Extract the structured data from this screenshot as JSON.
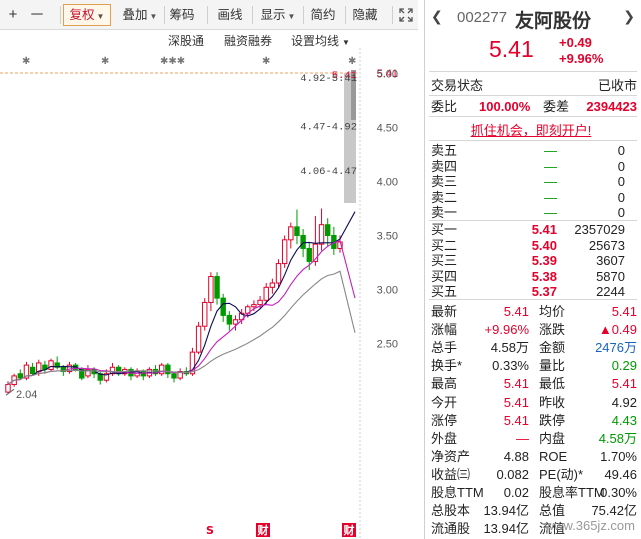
{
  "toolbar": {
    "plus": "+",
    "minus": "一",
    "fuquan": "复权",
    "diejia": "叠加",
    "chouma": "筹码",
    "huaxian": "画线",
    "xianshi": "显示",
    "jianyue": "简约",
    "yincang": "隐藏"
  },
  "subbar": {
    "shengutong": "深股通",
    "rongzi": "融资融券",
    "shezhi": "设置均线",
    "star": "✱",
    "stars": "✱✱✱"
  },
  "chart_data": {
    "type": "candlestick",
    "price_ticks": [
      "5.41",
      "5.00",
      "4.50",
      "4.00",
      "3.50",
      "3.00",
      "2.50"
    ],
    "last_price_label": "5.41",
    "annotations": [
      {
        "text": "5.41",
        "price": 5.41
      },
      {
        "text": "4.92-5.41",
        "price": 4.92
      },
      {
        "text": "4.47-4.92",
        "price": 4.47
      },
      {
        "text": "4.06-4.47",
        "price": 4.06
      }
    ],
    "low_label": "2.04",
    "markers": [
      "S",
      "财",
      "S",
      "财"
    ],
    "candles": [
      [
        2.05,
        2.12,
        2.04,
        2.15
      ],
      [
        2.12,
        2.2,
        2.1,
        2.22
      ],
      [
        2.22,
        2.18,
        2.16,
        2.26
      ],
      [
        2.18,
        2.3,
        2.16,
        2.33
      ],
      [
        2.28,
        2.22,
        2.2,
        2.32
      ],
      [
        2.24,
        2.32,
        2.2,
        2.35
      ],
      [
        2.3,
        2.26,
        2.22,
        2.34
      ],
      [
        2.26,
        2.34,
        2.24,
        2.36
      ],
      [
        2.32,
        2.28,
        2.26,
        2.38
      ],
      [
        2.28,
        2.24,
        2.2,
        2.3
      ],
      [
        2.24,
        2.3,
        2.22,
        2.33
      ],
      [
        2.3,
        2.26,
        2.24,
        2.32
      ],
      [
        2.26,
        2.18,
        2.16,
        2.28
      ],
      [
        2.2,
        2.26,
        2.18,
        2.3
      ],
      [
        2.26,
        2.22,
        2.18,
        2.28
      ],
      [
        2.22,
        2.16,
        2.12,
        2.24
      ],
      [
        2.16,
        2.22,
        2.14,
        2.26
      ],
      [
        2.22,
        2.28,
        2.2,
        2.32
      ],
      [
        2.28,
        2.22,
        2.2,
        2.3
      ],
      [
        2.22,
        2.26,
        2.2,
        2.28
      ],
      [
        2.26,
        2.2,
        2.16,
        2.28
      ],
      [
        2.2,
        2.24,
        2.18,
        2.27
      ],
      [
        2.24,
        2.2,
        2.16,
        2.26
      ],
      [
        2.2,
        2.26,
        2.18,
        2.28
      ],
      [
        2.26,
        2.22,
        2.2,
        2.3
      ],
      [
        2.22,
        2.3,
        2.2,
        2.32
      ],
      [
        2.3,
        2.22,
        2.18,
        2.32
      ],
      [
        2.22,
        2.18,
        2.14,
        2.24
      ],
      [
        2.18,
        2.24,
        2.16,
        2.27
      ],
      [
        2.24,
        2.22,
        2.2,
        2.28
      ],
      [
        2.22,
        2.42,
        2.2,
        2.46
      ],
      [
        2.42,
        2.66,
        2.4,
        2.7
      ],
      [
        2.66,
        2.88,
        2.62,
        2.92
      ],
      [
        2.88,
        3.12,
        2.8,
        3.16
      ],
      [
        3.12,
        2.92,
        2.86,
        3.16
      ],
      [
        2.92,
        2.76,
        2.7,
        2.96
      ],
      [
        2.76,
        2.68,
        2.62,
        2.8
      ],
      [
        2.68,
        2.72,
        2.62,
        2.76
      ],
      [
        2.72,
        2.78,
        2.68,
        2.82
      ],
      [
        2.78,
        2.84,
        2.74,
        2.86
      ],
      [
        2.84,
        2.86,
        2.8,
        2.9
      ],
      [
        2.86,
        2.9,
        2.82,
        2.94
      ],
      [
        2.9,
        3.02,
        2.86,
        3.06
      ],
      [
        3.02,
        3.06,
        2.96,
        3.1
      ],
      [
        3.06,
        3.24,
        3.02,
        3.28
      ],
      [
        3.24,
        3.46,
        3.2,
        3.5
      ],
      [
        3.46,
        3.58,
        3.38,
        3.62
      ],
      [
        3.58,
        3.5,
        3.42,
        3.74
      ],
      [
        3.5,
        3.38,
        3.3,
        3.56
      ],
      [
        3.38,
        3.26,
        3.18,
        3.44
      ],
      [
        3.26,
        3.42,
        3.22,
        3.68
      ],
      [
        3.42,
        3.6,
        3.36,
        3.75
      ],
      [
        3.6,
        3.5,
        3.4,
        3.66
      ],
      [
        3.5,
        3.38,
        3.32,
        3.58
      ],
      [
        3.38,
        3.44,
        3.34,
        3.5
      ]
    ]
  },
  "stock": {
    "code": "002277",
    "name": "友阿股份",
    "price": "5.41",
    "change": "+0.49",
    "change_pct": "+9.96%",
    "status_label": "交易状态",
    "status_value": "已收市",
    "weibi_label": "委比",
    "weibi_value": "100.00%",
    "weicha_label": "委差",
    "weicha_value": "2394423",
    "ad_link": "抓住机会，即刻开户!"
  },
  "orderbook": {
    "sell": [
      {
        "label": "卖五",
        "price": "—",
        "vol": "0"
      },
      {
        "label": "卖四",
        "price": "—",
        "vol": "0"
      },
      {
        "label": "卖三",
        "price": "—",
        "vol": "0"
      },
      {
        "label": "卖二",
        "price": "—",
        "vol": "0"
      },
      {
        "label": "卖一",
        "price": "—",
        "vol": "0"
      }
    ],
    "buy": [
      {
        "label": "买一",
        "price": "5.41",
        "vol": "2357029"
      },
      {
        "label": "买二",
        "price": "5.40",
        "vol": "25673"
      },
      {
        "label": "买三",
        "price": "5.39",
        "vol": "3607"
      },
      {
        "label": "买四",
        "price": "5.38",
        "vol": "5870"
      },
      {
        "label": "买五",
        "price": "5.37",
        "vol": "2244"
      }
    ]
  },
  "stats": [
    [
      {
        "l": "最新",
        "v": "5.41",
        "c": "red"
      },
      {
        "l": "均价",
        "v": "5.41",
        "c": "red"
      }
    ],
    [
      {
        "l": "涨幅",
        "v": "+9.96%",
        "c": "red"
      },
      {
        "l": "涨跌",
        "v": "▲0.49",
        "c": "red"
      }
    ],
    [
      {
        "l": "总手",
        "v": "4.58万",
        "c": ""
      },
      {
        "l": "金额",
        "v": "2476万",
        "c": "blue"
      }
    ],
    [
      {
        "l": "换手*",
        "v": "0.33%",
        "c": ""
      },
      {
        "l": "量比",
        "v": "0.29",
        "c": "green"
      }
    ],
    [
      {
        "l": "最高",
        "v": "5.41",
        "c": "red"
      },
      {
        "l": "最低",
        "v": "5.41",
        "c": "red"
      }
    ],
    [
      {
        "l": "今开",
        "v": "5.41",
        "c": "red"
      },
      {
        "l": "昨收",
        "v": "4.92",
        "c": ""
      }
    ],
    [
      {
        "l": "涨停",
        "v": "5.41",
        "c": "red"
      },
      {
        "l": "跌停",
        "v": "4.43",
        "c": "green"
      }
    ],
    [
      {
        "l": "外盘",
        "v": "—",
        "c": "red"
      },
      {
        "l": "内盘",
        "v": "4.58万",
        "c": "green"
      }
    ],
    [
      {
        "l": "净资产",
        "v": "4.88",
        "c": ""
      },
      {
        "l": "ROE",
        "v": "1.70%",
        "c": ""
      }
    ],
    [
      {
        "l": "收益㈢",
        "v": "0.082",
        "c": ""
      },
      {
        "l": "PE(动)*",
        "v": "49.46",
        "c": ""
      }
    ],
    [
      {
        "l": "股息TTM",
        "v": "0.02",
        "c": ""
      },
      {
        "l": "股息率TTM",
        "v": "0.30%",
        "c": ""
      }
    ],
    [
      {
        "l": "总股本",
        "v": "13.94亿",
        "c": ""
      },
      {
        "l": "总值",
        "v": "75.42亿",
        "c": ""
      }
    ],
    [
      {
        "l": "流通股",
        "v": "13.94亿",
        "c": ""
      },
      {
        "l": "流值",
        "v": "",
        "c": ""
      }
    ]
  ],
  "watermark": "www.365jz.com",
  "colors": {
    "up": "#e4002b",
    "down": "#009a00",
    "ma5": "#0a0a5a",
    "ma10": "#c020c0",
    "ma20": "#888888"
  }
}
